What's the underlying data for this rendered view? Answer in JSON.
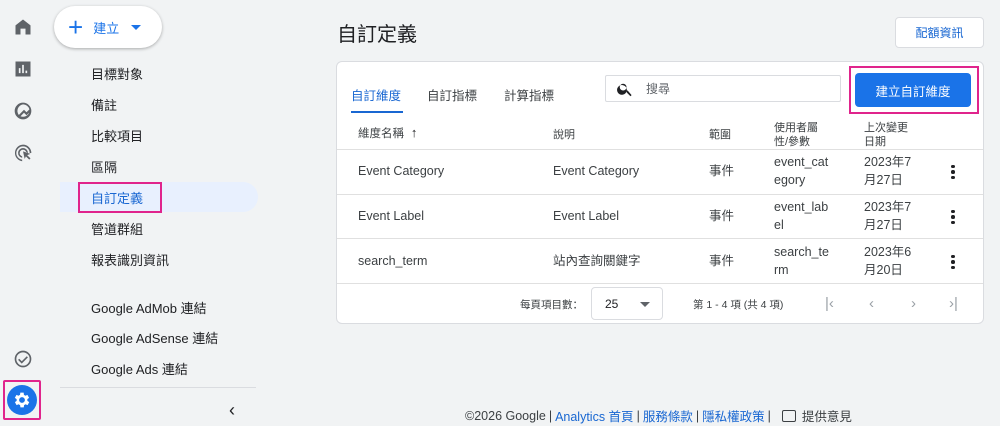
{
  "nav": {
    "create_label": "建立",
    "items": [
      {
        "label": "目標對象"
      },
      {
        "label": "備註"
      },
      {
        "label": "比較項目"
      },
      {
        "label": "區隔"
      },
      {
        "label": "自訂定義"
      },
      {
        "label": "管道群組"
      },
      {
        "label": "報表識別資訊"
      },
      {
        "label": "Google AdMob 連結"
      },
      {
        "label": "Google AdSense 連結"
      },
      {
        "label": "Google Ads 連結"
      }
    ]
  },
  "header": {
    "title": "自訂定義",
    "quota_label": "配額資訊"
  },
  "card": {
    "tabs": [
      {
        "label": "自訂維度"
      },
      {
        "label": "自訂指標"
      },
      {
        "label": "計算指標"
      }
    ],
    "search_placeholder": "搜尋",
    "create_button": "建立自訂維度",
    "columns": {
      "name": "維度名稱",
      "description": "說明",
      "scope": "範圍",
      "param_1": "使用者屬",
      "param_2": "性/參數",
      "modified_1": "上次變更",
      "modified_2": "日期"
    },
    "rows": [
      {
        "name": "Event Category",
        "description": "Event Category",
        "scope": "事件",
        "param_1": "event_cat",
        "param_2": "egory",
        "date_1": "2023年7",
        "date_2": "月27日"
      },
      {
        "name": "Event Label",
        "description": "Event Label",
        "scope": "事件",
        "param_1": "event_lab",
        "param_2": "el",
        "date_1": "2023年7",
        "date_2": "月27日"
      },
      {
        "name": "search_term",
        "description": "站內查詢關鍵字",
        "scope": "事件",
        "param_1": "search_te",
        "param_2": "rm",
        "date_1": "2023年6",
        "date_2": "月20日"
      }
    ],
    "pagination": {
      "rows_per_page_label": "每頁項目數：",
      "rows_per_page": "25",
      "range": "第 1 - 4 項 (共 4 項)"
    }
  },
  "footer": {
    "copyright": "©2026 Google",
    "home": "Analytics 首頁",
    "terms": "服務條款",
    "privacy": "隱私權政策",
    "feedback": "提供意見"
  },
  "colors": {
    "accent": "#1a73e8",
    "highlight": "#e0248c"
  }
}
